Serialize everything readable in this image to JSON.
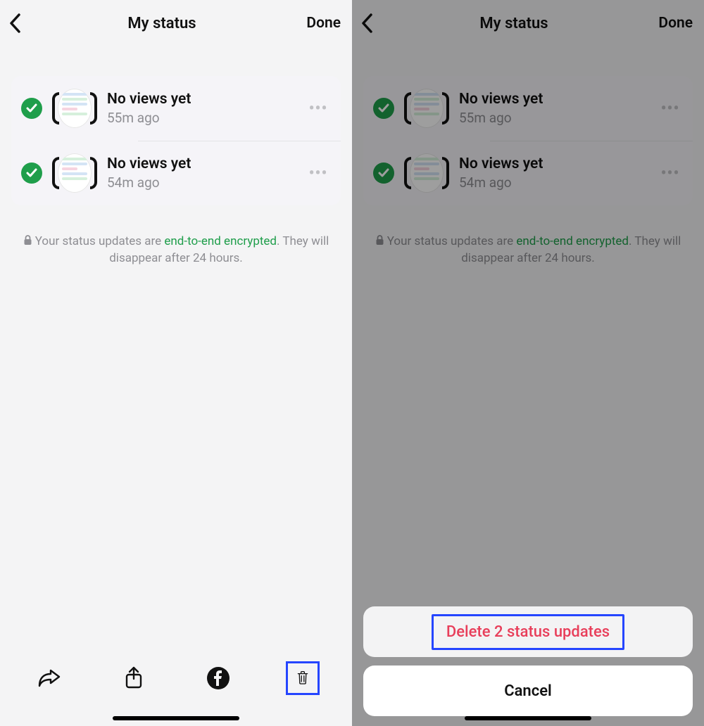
{
  "header": {
    "title": "My status",
    "done_label": "Done"
  },
  "statuses": [
    {
      "views_text": "No views yet",
      "time_text": "55m ago"
    },
    {
      "views_text": "No views yet",
      "time_text": "54m ago"
    }
  ],
  "encryption": {
    "prefix": "Your status updates are ",
    "link": "end-to-end encrypted",
    "suffix": ". They will disappear after 24 hours."
  },
  "action_sheet": {
    "delete_label": "Delete 2 status updates",
    "cancel_label": "Cancel"
  },
  "colors": {
    "accent_green": "#1f9e4b",
    "danger_red": "#e83e5a",
    "highlight_blue": "#2545ff"
  }
}
